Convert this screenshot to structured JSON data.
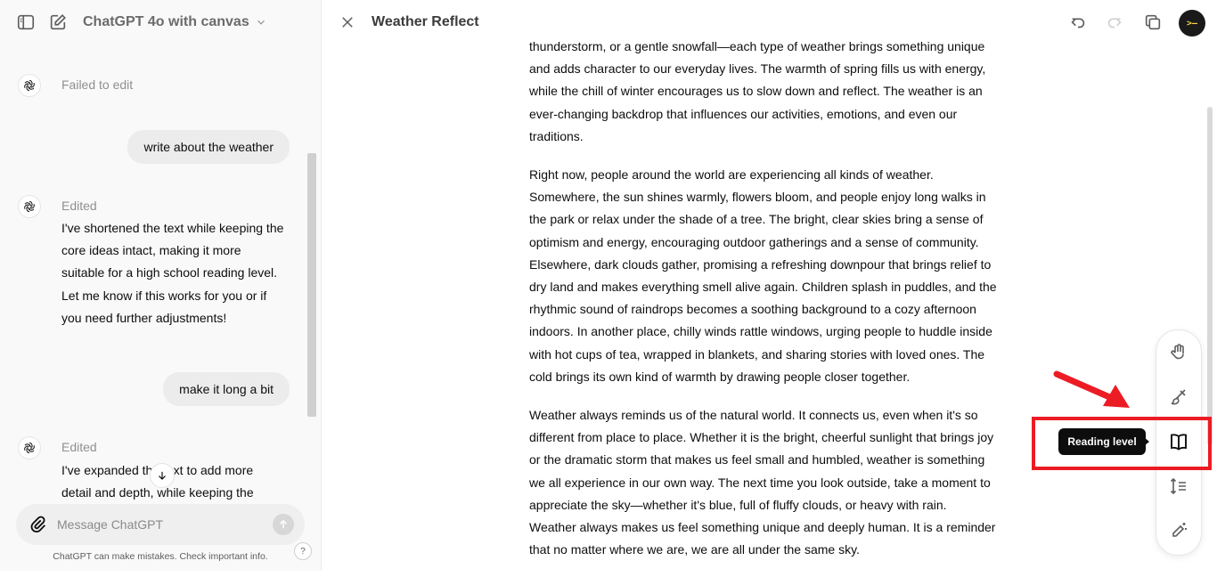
{
  "sidebar": {
    "model_name": "ChatGPT 4o with canvas",
    "messages": [
      {
        "role": "assistant",
        "status": "Failed to edit"
      },
      {
        "role": "user",
        "text": "write about the weather"
      },
      {
        "role": "assistant",
        "status": "Edited",
        "text": "I've shortened the text while keeping the core ideas intact, making it more suitable for a high school reading level. Let me know if this works for you or if you need further adjustments!"
      },
      {
        "role": "user",
        "text": "make it long a bit"
      },
      {
        "role": "assistant",
        "status": "Edited",
        "text": "I've expanded the text to add more detail and depth, while keeping the"
      }
    ],
    "composer_placeholder": "Message ChatGPT",
    "disclaimer": "ChatGPT can make mistakes. Check important info.",
    "help_label": "?"
  },
  "canvas": {
    "title": "Weather Reflect",
    "avatar_text": ">–",
    "paragraphs": [
      "thunderstorm, or a gentle snowfall—each type of weather brings something unique and adds character to our everyday lives. The warmth of spring fills us with energy, while the chill of winter encourages us to slow down and reflect. The weather is an ever-changing backdrop that influences our activities, emotions, and even our traditions.",
      "Right now, people around the world are experiencing all kinds of weather. Somewhere, the sun shines warmly, flowers bloom, and people enjoy long walks in the park or relax under the shade of a tree. The bright, clear skies bring a sense of optimism and energy, encouraging outdoor gatherings and a sense of community. Elsewhere, dark clouds gather, promising a refreshing downpour that brings relief to dry land and makes everything smell alive again. Children splash in puddles, and the rhythmic sound of raindrops becomes a soothing background to a cozy afternoon indoors. In another place, chilly winds rattle windows, urging people to huddle inside with hot cups of tea, wrapped in blankets, and sharing stories with loved ones. The cold brings its own kind of warmth by drawing people closer together.",
      "Weather always reminds us of the natural world. It connects us, even when it's so different from place to place. Whether it is the bright, cheerful sunlight that brings joy or the dramatic storm that makes us feel small and humbled, weather is something we all experience in our own way. The next time you look outside, take a moment to appreciate the sky—whether it's blue, full of fluffy clouds, or heavy with rain. Weather always makes us feel something unique and deeply human. It is a reminder that no matter where we are, we are all under the same sky."
    ],
    "tooltip": "Reading level",
    "tools": [
      "hand-icon",
      "brush-icon",
      "book-icon",
      "adjust-length-icon",
      "pencil-sparkle-icon"
    ]
  },
  "colors": {
    "highlight": "#ec1c24",
    "tooltip_bg": "#0d0d0d",
    "sidebar_bg": "#f9f9f9"
  }
}
